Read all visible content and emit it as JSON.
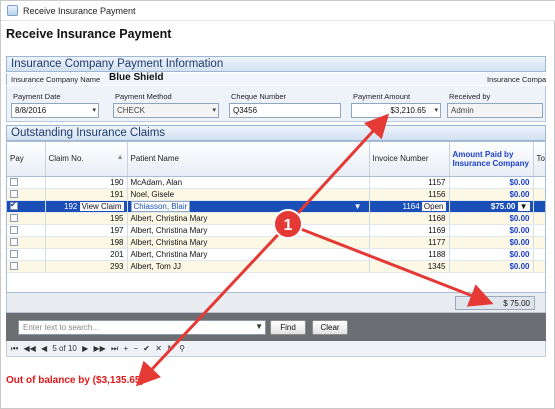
{
  "window": {
    "title": "Receive Insurance Payment"
  },
  "page": {
    "title": "Receive Insurance Payment"
  },
  "payment_info": {
    "header": "Insurance Company Payment Information",
    "company_label": "Insurance Company Name",
    "company_name": "Blue Shield",
    "company_label_right": "Insurance Compa",
    "date_label": "Payment Date",
    "date_value": "8/8/2016",
    "method_label": "Payment Method",
    "method_value": "CHECK",
    "cheque_label": "Cheque Number",
    "cheque_value": "Q3456",
    "amount_label": "Payment Amount",
    "amount_value": "$3,210.65",
    "received_label": "Received by",
    "received_value": "Admin"
  },
  "claims": {
    "header": "Outstanding Insurance Claims",
    "columns": {
      "pay": "Pay",
      "claim": "Claim No.",
      "patient": "Patient Name",
      "invoice": "Invoice Number",
      "amount": "Amount Paid by Insurance Company",
      "total": "Tot Ap"
    },
    "rows": [
      {
        "claim": "190",
        "patient": "McAdam, Alan",
        "invoice": "1157",
        "amount": "$0.00"
      },
      {
        "claim": "191",
        "patient": "Noel, Gisele",
        "invoice": "1156",
        "amount": "$0.00"
      },
      {
        "claim": "192",
        "view_claim": "View Claim",
        "patient": "Chiasson, Blair",
        "invoice": "1164",
        "status": "Open",
        "amount": "$75.00"
      },
      {
        "claim": "195",
        "patient": "Albert, Christina Mary",
        "invoice": "1168",
        "amount": "$0.00"
      },
      {
        "claim": "197",
        "patient": "Albert, Christina Mary",
        "invoice": "1169",
        "amount": "$0.00"
      },
      {
        "claim": "198",
        "patient": "Albert, Christina Mary",
        "invoice": "1177",
        "amount": "$0.00"
      },
      {
        "claim": "201",
        "patient": "Albert, Christina Mary",
        "invoice": "1188",
        "amount": "$0.00"
      },
      {
        "claim": "293",
        "patient": "Albert, Tom JJ",
        "invoice": "1345",
        "amount": "$0.00"
      }
    ],
    "total": "$ 75.00"
  },
  "search": {
    "placeholder": "Enter text to search...",
    "find_label": "Find",
    "clear_label": "Clear"
  },
  "pager": {
    "text": "5 of 10"
  },
  "status": {
    "balance": "Out of balance by ($3,135.65)"
  },
  "callout": {
    "number": "1",
    "color": "#e53935"
  }
}
